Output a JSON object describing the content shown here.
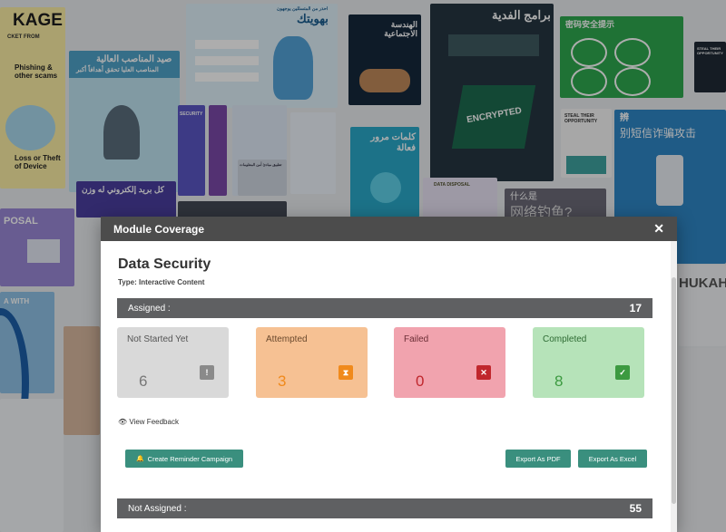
{
  "modal": {
    "header_title": "Module Coverage",
    "close_glyph": "✕",
    "module_title": "Data Security",
    "type_label": "Type: Interactive Content",
    "assigned": {
      "label": "Assigned :",
      "count": "17"
    },
    "not_assigned": {
      "label": "Not Assigned :",
      "count": "55"
    },
    "stats": [
      {
        "label": "Not Started Yet",
        "value": "6",
        "icon": "exclamation-icon",
        "glyph": "!"
      },
      {
        "label": "Attempted",
        "value": "3",
        "icon": "hourglass-icon",
        "glyph": "⧗"
      },
      {
        "label": "Failed",
        "value": "0",
        "icon": "x-icon",
        "glyph": "✕"
      },
      {
        "label": "Completed",
        "value": "8",
        "icon": "check-icon",
        "glyph": "✓"
      }
    ],
    "view_feedback": "View Feedback",
    "eye_glyph": "👁",
    "buttons": {
      "reminder": "Create Reminder Campaign",
      "reminder_glyph": "🔔",
      "export_pdf": "Export As PDF",
      "export_excel": "Export As Excel"
    }
  },
  "background": {
    "tile_texts": [
      "KAGE",
      "CKET FROM",
      "Phishing & other scams",
      "Loss or Theft of Device",
      "صيد المناصب العالية",
      "المناصب العليا تحقق أهدافاً أكبر",
      "احذر من المتسللين يوجهون",
      "بهويتك",
      "الهندسة الاجتماعية",
      "برامج الفدية",
      "ENCRYPTED",
      "密码安全提示",
      "STEAL THEIR OPPORTUNITY",
      "STEAL THEIR OPPORTUNITY",
      "辨",
      "别短信诈骗攻击",
      "SECURITY",
      "كلمات مرور فعالة",
      "تطبيق مبادئ أمن المعلومات",
      "DATA DISPOSAL",
      "什么是",
      "网络钓鱼?",
      "POSAL",
      "A WITH",
      "كل بريد إلكتروني له وزن",
      "HUKAH"
    ]
  },
  "colors": {
    "header_bg": "#4c4c4c",
    "bar_bg": "#5f6062",
    "button_bg": "#3a8f7e",
    "not_started": "#d9d9d9",
    "attempted": "#f6c193",
    "failed": "#f1a3ae",
    "completed": "#b6e3b9"
  }
}
